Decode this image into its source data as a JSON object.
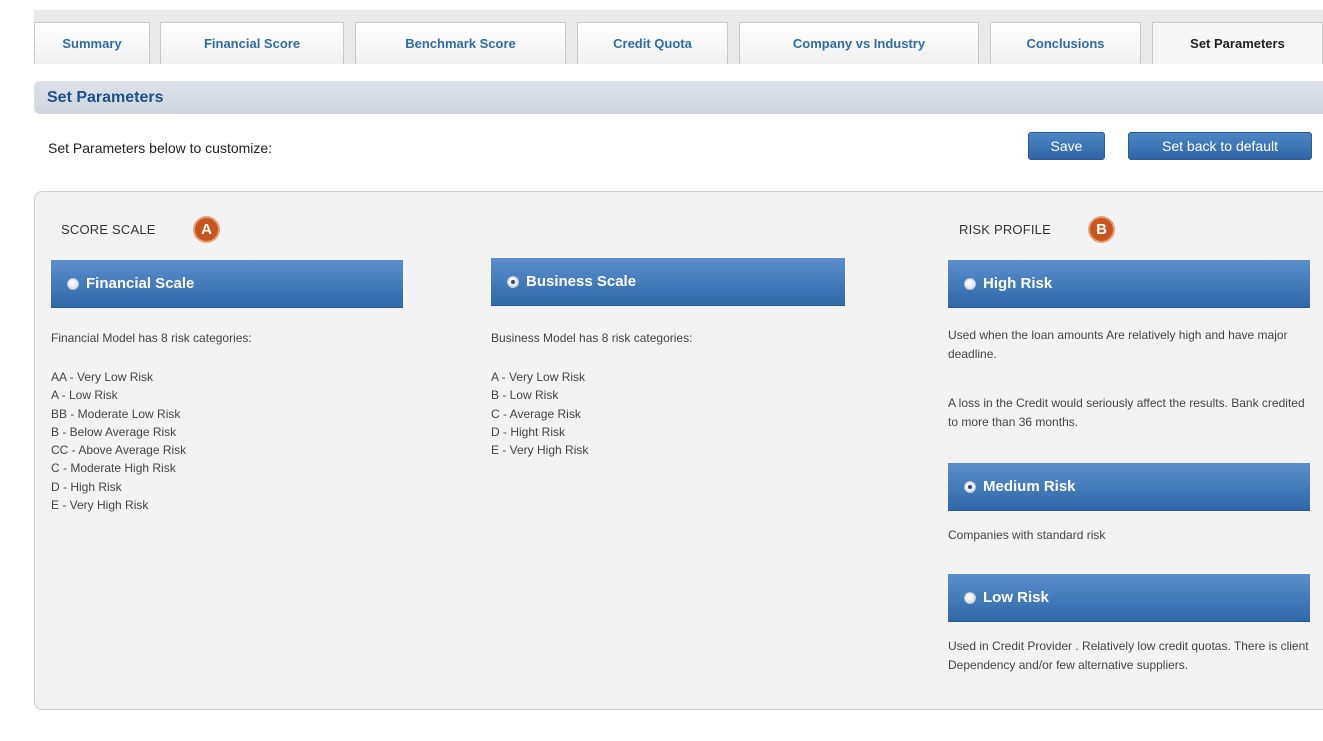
{
  "tabs": [
    {
      "label": "Summary"
    },
    {
      "label": "Financial Score"
    },
    {
      "label": "Benchmark Score"
    },
    {
      "label": "Credit Quota"
    },
    {
      "label": "Company vs Industry"
    },
    {
      "label": "Conclusions"
    },
    {
      "label": "Set Parameters",
      "active": true
    }
  ],
  "header": {
    "title": "Set Parameters"
  },
  "intro": "Set Parameters below to customize:",
  "buttons": {
    "save": "Save",
    "reset": "Set back to default"
  },
  "score_scale": {
    "label": "SCORE SCALE",
    "badge": "A",
    "financial": {
      "title": "Financial Scale",
      "selected": false,
      "description": "Financial Model has 8 risk categories:",
      "items": [
        "AA - Very Low Risk",
        "A - Low Risk",
        "BB - Moderate Low Risk",
        "B - Below Average Risk",
        "CC - Above Average Risk",
        "C - Moderate High Risk",
        "D - High Risk",
        "E - Very High Risk"
      ]
    },
    "business": {
      "title": "Business Scale",
      "selected": true,
      "description": "Business Model has 8 risk categories:",
      "items": [
        "A - Very Low Risk",
        "B - Low Risk",
        "C - Average Risk",
        "D - Hight Risk",
        "E - Very High Risk"
      ]
    }
  },
  "risk_profile": {
    "label": "RISK PROFILE",
    "badge": "B",
    "high": {
      "title": "High Risk",
      "selected": false,
      "description_1": "Used when the loan amounts Are relatively high and have major deadline.",
      "description_2": "A loss in the Credit would seriously affect the results. Bank credited to more than 36 months."
    },
    "medium": {
      "title": "Medium Risk",
      "selected": true,
      "description": "Companies with standard risk"
    },
    "low": {
      "title": "Low Risk",
      "selected": false,
      "description": "Used in Credit Provider . Relatively low credit quotas. There is client Dependency and/or few alternative suppliers."
    }
  }
}
